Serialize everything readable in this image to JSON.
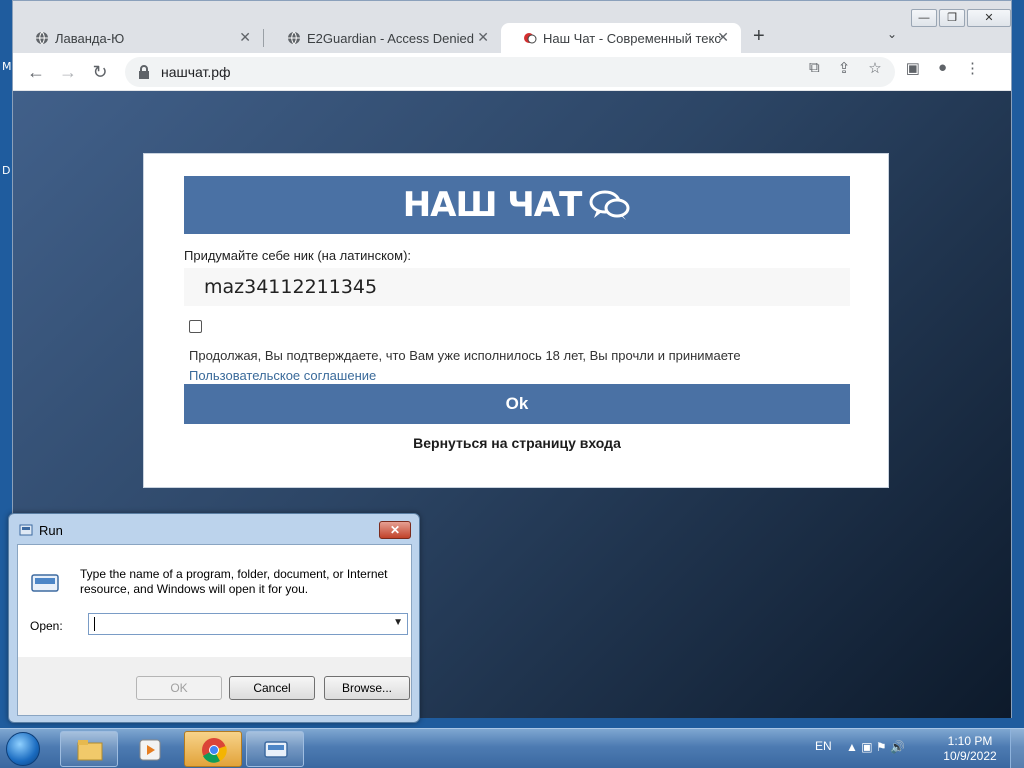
{
  "desktop": {
    "frag1": "M",
    "frag2": "D"
  },
  "window_controls": {
    "minimize": "—",
    "restore": "❐",
    "close": "✕"
  },
  "tabs": [
    {
      "title": "Лаванда-Ю",
      "close": "✕"
    },
    {
      "title": "E2Guardian - Access Denied",
      "close": "✕"
    },
    {
      "title": "Наш Чат - Современный тексто",
      "close": "✕"
    }
  ],
  "new_tab": "+",
  "tab_list": "⌄",
  "toolbar": {
    "back": "←",
    "forward": "→",
    "reload": "↻",
    "url": "нашчат.рф"
  },
  "toolbar_right": {
    "translate": "⧉",
    "share": "⇪",
    "bookmark": "☆",
    "sidepanel": "▣",
    "profile": "●",
    "menu": "⋮"
  },
  "page": {
    "banner_title": "НАШ ЧАТ",
    "nick_label": "Придумайте себе ник (на латинском):",
    "nick_value": "maz34112211345",
    "agree_text": "Продолжая, Вы подтверждаете, что Вам уже исполнилось 18 лет, Вы прочли и принимаете ",
    "agree_link": "Пользовательское соглашение",
    "ok_label": "Ok",
    "back_link": "Вернуться на страницу входа"
  },
  "run_dialog": {
    "title": "Run",
    "close": "✕",
    "description": "Type the name of a program, folder, document, or Internet resource, and Windows will open it for you.",
    "open_label": "Open:",
    "open_value": "",
    "ok": "OK",
    "cancel": "Cancel",
    "browse": "Browse..."
  },
  "taskbar": {
    "lang": "EN",
    "tray": "▲  ▣  ⚑  🔊",
    "time": "1:10 PM",
    "date": "10/9/2022"
  }
}
